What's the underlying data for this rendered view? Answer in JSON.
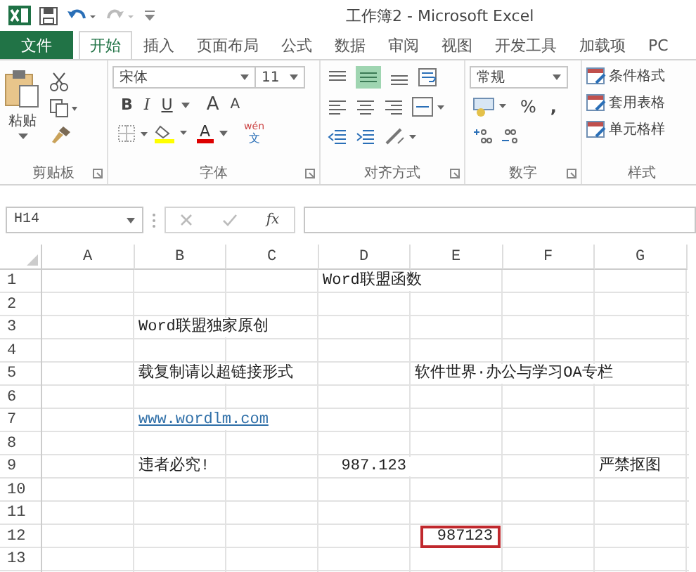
{
  "window": {
    "title": "工作簿2 - Microsoft Excel"
  },
  "tabs": [
    {
      "label": "文件",
      "kind": "file",
      "selected": false
    },
    {
      "label": "开始",
      "kind": "tab",
      "selected": true
    },
    {
      "label": "插入",
      "kind": "tab",
      "selected": false
    },
    {
      "label": "页面布局",
      "kind": "tab",
      "selected": false
    },
    {
      "label": "公式",
      "kind": "tab",
      "selected": false
    },
    {
      "label": "数据",
      "kind": "tab",
      "selected": false
    },
    {
      "label": "审阅",
      "kind": "tab",
      "selected": false
    },
    {
      "label": "视图",
      "kind": "tab",
      "selected": false
    },
    {
      "label": "开发工具",
      "kind": "tab",
      "selected": false
    },
    {
      "label": "加载项",
      "kind": "tab",
      "selected": false
    },
    {
      "label": "PC",
      "kind": "tab",
      "selected": false
    }
  ],
  "ribbon": {
    "clipboard": {
      "paste_label": "粘贴",
      "group_label": "剪贴板"
    },
    "font": {
      "font_name": "宋体",
      "font_size": "11",
      "style_buttons": [
        "B",
        "I",
        "U"
      ],
      "grow": "A",
      "shrink": "A",
      "font_color": "A",
      "phonetic_top": "wén",
      "phonetic_bottom": "文",
      "group_label": "字体"
    },
    "alignment": {
      "group_label": "对齐方式"
    },
    "number": {
      "format": "常规",
      "percent": "%",
      "comma": ",",
      "group_label": "数字"
    },
    "styles": {
      "items": [
        "条件格式",
        "套用表格",
        "单元格样"
      ],
      "group_label": "样式"
    }
  },
  "formula_bar": {
    "name_box": "H14",
    "fx": "fx"
  },
  "columns": [
    "A",
    "B",
    "C",
    "D",
    "E",
    "F",
    "G"
  ],
  "rows": [
    {
      "header": "1",
      "cells": [
        {},
        {},
        {},
        {
          "text": "Word联盟函数",
          "kind": "text"
        },
        {},
        {},
        {}
      ]
    },
    {
      "header": "2",
      "cells": [
        {},
        {},
        {},
        {},
        {},
        {},
        {}
      ]
    },
    {
      "header": "3",
      "cells": [
        {},
        {
          "text": "Word联盟独家原创",
          "kind": "text"
        },
        {},
        {},
        {},
        {},
        {}
      ]
    },
    {
      "header": "4",
      "cells": [
        {},
        {},
        {},
        {},
        {},
        {},
        {}
      ]
    },
    {
      "header": "5",
      "cells": [
        {},
        {
          "text": "载复制请以超链接形式",
          "kind": "text"
        },
        {},
        {},
        {
          "text": "软件世界·办公与学习OA专栏",
          "kind": "text"
        },
        {},
        {}
      ]
    },
    {
      "header": "6",
      "cells": [
        {},
        {},
        {},
        {},
        {},
        {},
        {}
      ]
    },
    {
      "header": "7",
      "cells": [
        {},
        {
          "text": "www.wordlm.com",
          "kind": "link"
        },
        {},
        {},
        {},
        {},
        {}
      ]
    },
    {
      "header": "8",
      "cells": [
        {},
        {},
        {},
        {},
        {},
        {},
        {}
      ]
    },
    {
      "header": "9",
      "cells": [
        {},
        {
          "text": "违者必究!",
          "kind": "text"
        },
        {},
        {
          "text": "987.123",
          "kind": "number"
        },
        {},
        {},
        {
          "text": "严禁抠图",
          "kind": "text"
        }
      ]
    },
    {
      "header": "10",
      "cells": [
        {},
        {},
        {},
        {},
        {},
        {},
        {}
      ]
    },
    {
      "header": "11",
      "cells": [
        {},
        {},
        {},
        {},
        {},
        {},
        {}
      ]
    },
    {
      "header": "12",
      "cells": [
        {},
        {},
        {},
        {},
        {
          "text": "987123",
          "kind": "boxed"
        },
        {},
        {}
      ]
    },
    {
      "header": "13",
      "cells": [
        {},
        {},
        {},
        {},
        {},
        {},
        {}
      ]
    }
  ]
}
